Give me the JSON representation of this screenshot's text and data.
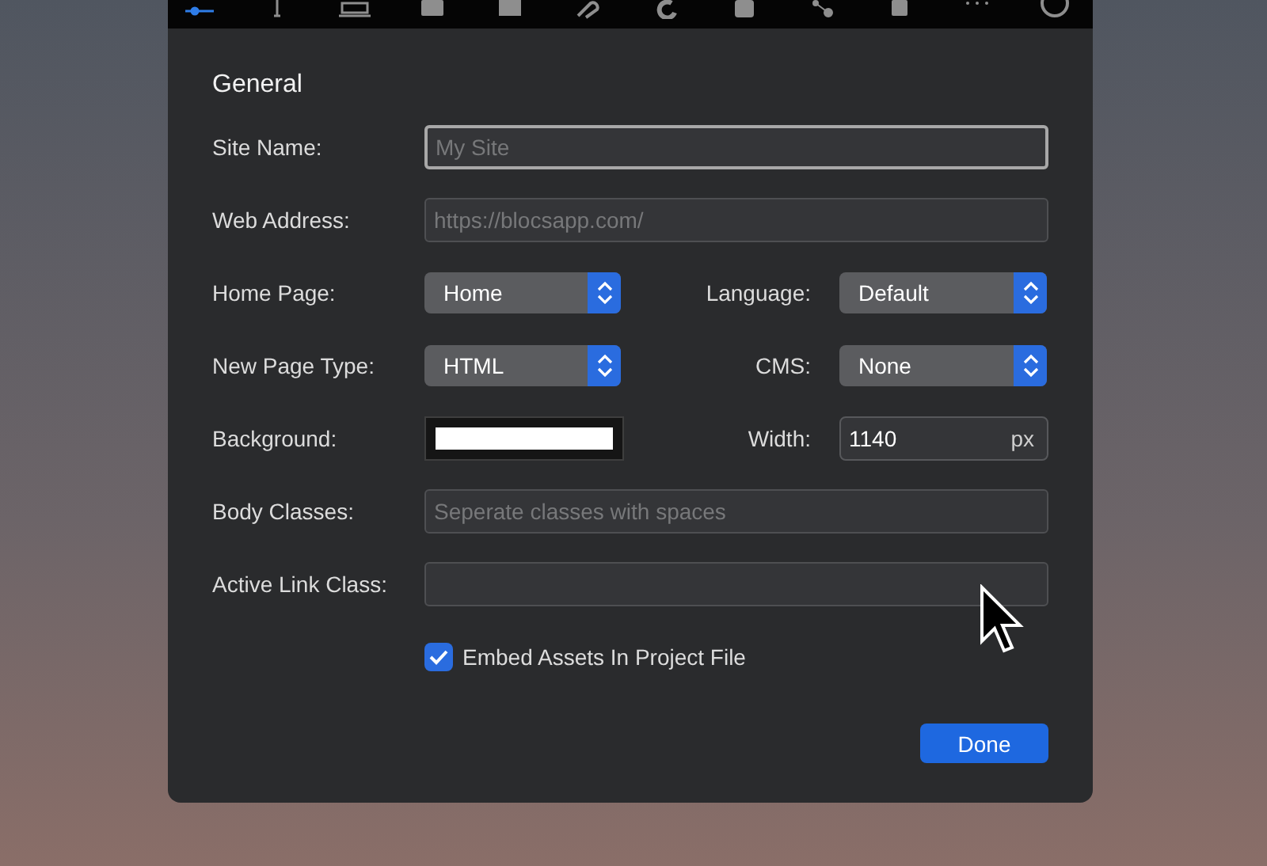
{
  "toolbar": {
    "items": [
      {
        "selected": true
      },
      {
        "selected": false
      },
      {
        "selected": false
      },
      {
        "selected": false
      },
      {
        "selected": false
      },
      {
        "selected": false
      },
      {
        "selected": false
      },
      {
        "selected": false
      },
      {
        "selected": false
      },
      {
        "selected": false
      },
      {
        "selected": false
      },
      {
        "selected": false
      }
    ]
  },
  "section_title": "General",
  "site_name": {
    "label": "Site Name:",
    "placeholder": "My Site",
    "focused": true
  },
  "web_address": {
    "label": "Web Address:",
    "placeholder": "https://blocsapp.com/",
    "focused": false
  },
  "home_page": {
    "label": "Home Page:",
    "value": "Home"
  },
  "language": {
    "label": "Language:",
    "value": "Default"
  },
  "new_page_type": {
    "label": "New Page Type:",
    "value": "HTML"
  },
  "cms": {
    "label": "CMS:",
    "value": "None"
  },
  "background": {
    "label": "Background:"
  },
  "width": {
    "label": "Width:",
    "value": "1140",
    "unit": "px"
  },
  "body_classes": {
    "label": "Body Classes:",
    "placeholder": "Seperate classes with spaces",
    "focused": false
  },
  "active_link_class": {
    "label": "Active Link Class:",
    "focused": false
  },
  "embed_assets": {
    "label": "Embed Assets In Project File",
    "checked": true
  },
  "done_button": "Done"
}
